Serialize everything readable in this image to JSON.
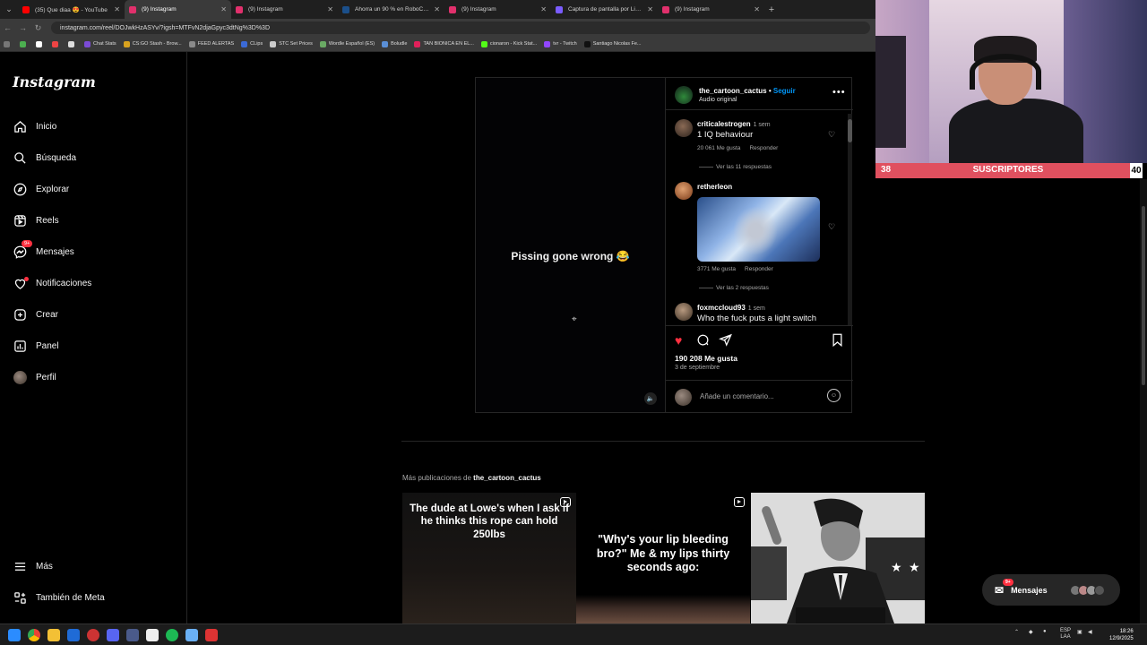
{
  "browser": {
    "tabs": [
      {
        "title": "(35) Que diaa 😍 - YouTube",
        "color": "#ff0000",
        "active": false
      },
      {
        "title": "(9) Instagram",
        "color": "#e1306c",
        "active": true
      },
      {
        "title": "(9) Instagram",
        "color": "#e1306c",
        "active": false
      },
      {
        "title": "Ahorra un 90 % en RoboCop: R",
        "color": "#1b4f8a",
        "active": false
      },
      {
        "title": "(9) Instagram",
        "color": "#e1306c",
        "active": false
      },
      {
        "title": "Captura de pantalla por Lightsh",
        "color": "#7a5cff",
        "active": false
      },
      {
        "title": "(9) Instagram",
        "color": "#e1306c",
        "active": false
      }
    ],
    "url": "instagram.com/reel/DOJwkHzASYv/?igsh=MTFvN2djaGpyc3dtNg%3D%3D",
    "bookmarks": [
      {
        "label": "Chat Stats",
        "color": "#7b4bd6"
      },
      {
        "label": "CS:GO Stash - Brow...",
        "color": "#d8a21e"
      },
      {
        "label": "FEED ALERTAS",
        "color": "#8a8a8a"
      },
      {
        "label": "CLips",
        "color": "#3b6ad6"
      },
      {
        "label": "STC Set Prices",
        "color": "#cccccc"
      },
      {
        "label": "Wordle Español (ES)",
        "color": "#6aaa64"
      },
      {
        "label": "Boludle",
        "color": "#5a8fd6"
      },
      {
        "label": "TAN BIONICA EN EL...",
        "color": "#e0205a"
      },
      {
        "label": "cionaron - Kick Stat...",
        "color": "#53fc18"
      },
      {
        "label": "tvr - Twitch",
        "color": "#9146ff"
      },
      {
        "label": "Santiago Nicolas Fe...",
        "color": "#111111"
      }
    ]
  },
  "sidebar": {
    "logo": "Instagram",
    "items": [
      {
        "label": "Inicio",
        "icon": "home-icon"
      },
      {
        "label": "Búsqueda",
        "icon": "search-icon"
      },
      {
        "label": "Explorar",
        "icon": "compass-icon"
      },
      {
        "label": "Reels",
        "icon": "reels-icon"
      },
      {
        "label": "Mensajes",
        "icon": "messenger-icon",
        "badge": "9+"
      },
      {
        "label": "Notificaciones",
        "icon": "heart-icon"
      },
      {
        "label": "Crear",
        "icon": "plus-square-icon"
      },
      {
        "label": "Panel",
        "icon": "chart-icon"
      },
      {
        "label": "Perfil",
        "icon": "avatar-icon"
      }
    ],
    "bottom": [
      {
        "label": "Más",
        "icon": "menu-icon"
      },
      {
        "label": "También de Meta",
        "icon": "meta-icon"
      }
    ]
  },
  "post": {
    "video_caption": "Pissing gone wrong 😂",
    "username": "the_cartoon_cactus",
    "follow_label": "Seguir",
    "separator": "•",
    "audio": "Audio original",
    "comments": [
      {
        "user": "criticalestrogen",
        "time": "1 sem",
        "text": "1 IQ behaviour",
        "likes": "20 061 Me gusta",
        "reply": "Responder",
        "replies": "Ver las 11 respuestas"
      },
      {
        "user": "retherleon",
        "time": "",
        "text": "",
        "likes": "3771 Me gusta",
        "reply": "Responder",
        "replies": "Ver las 2 respuestas"
      },
      {
        "user": "foxmccloud93",
        "time": "1 sem",
        "text": "Who the fuck puts a light switch"
      }
    ],
    "like_count": "190 208 Me gusta",
    "date": "3 de septiembre",
    "comment_placeholder": "Añade un comentario..."
  },
  "more": {
    "prefix": "Más publicaciones de",
    "user": "the_cartoon_cactus",
    "thumbs": [
      {
        "text": "The dude at Lowe's when I ask if he thinks this rope can hold 250lbs"
      },
      {
        "text": "\"Why's your lip bleeding bro?\" Me & my lips thirty seconds ago:"
      },
      {
        "text": ""
      }
    ]
  },
  "messages_pill": {
    "label": "Mensajes",
    "badge": "9+"
  },
  "overlay": {
    "sub_current": "38",
    "sub_label": "SUSCRIPTORES",
    "sub_goal": "40"
  },
  "taskbar": {
    "lang": "ESP",
    "layout": "LAA",
    "time": "18:26",
    "date": "12/9/2025"
  }
}
